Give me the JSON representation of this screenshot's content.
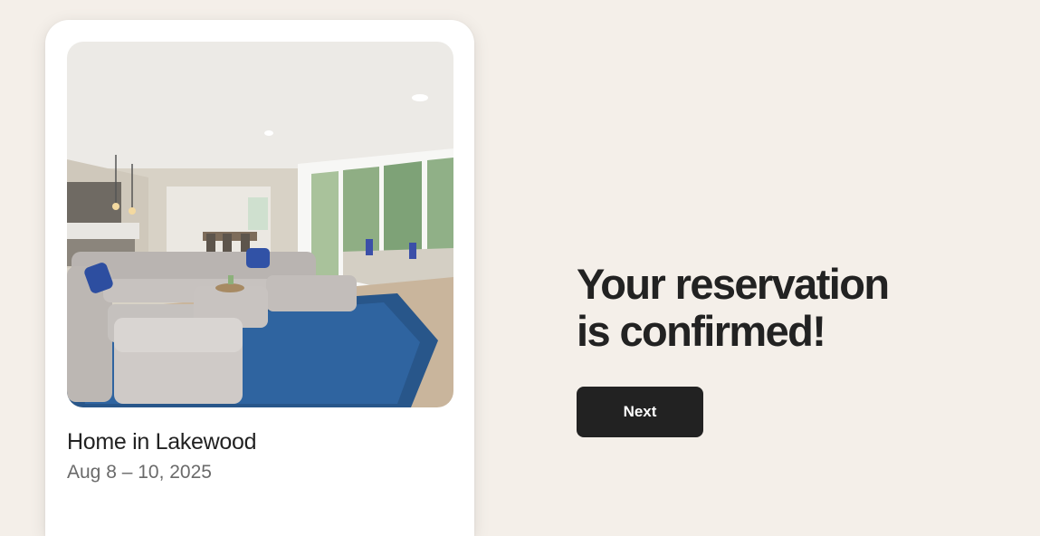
{
  "listing": {
    "title": "Home in Lakewood",
    "dates": "Aug 8 – 10, 2025",
    "photo_icon": "living-room-photo"
  },
  "confirmation": {
    "headline_line1": "Your reservation",
    "headline_line2": "is confirmed!",
    "next_label": "Next"
  },
  "colors": {
    "page_background": "#f4efe9",
    "card_background": "#ffffff",
    "button_background": "#222222",
    "button_text": "#ffffff",
    "primary_text": "#222222",
    "secondary_text": "#6a6a6a"
  }
}
